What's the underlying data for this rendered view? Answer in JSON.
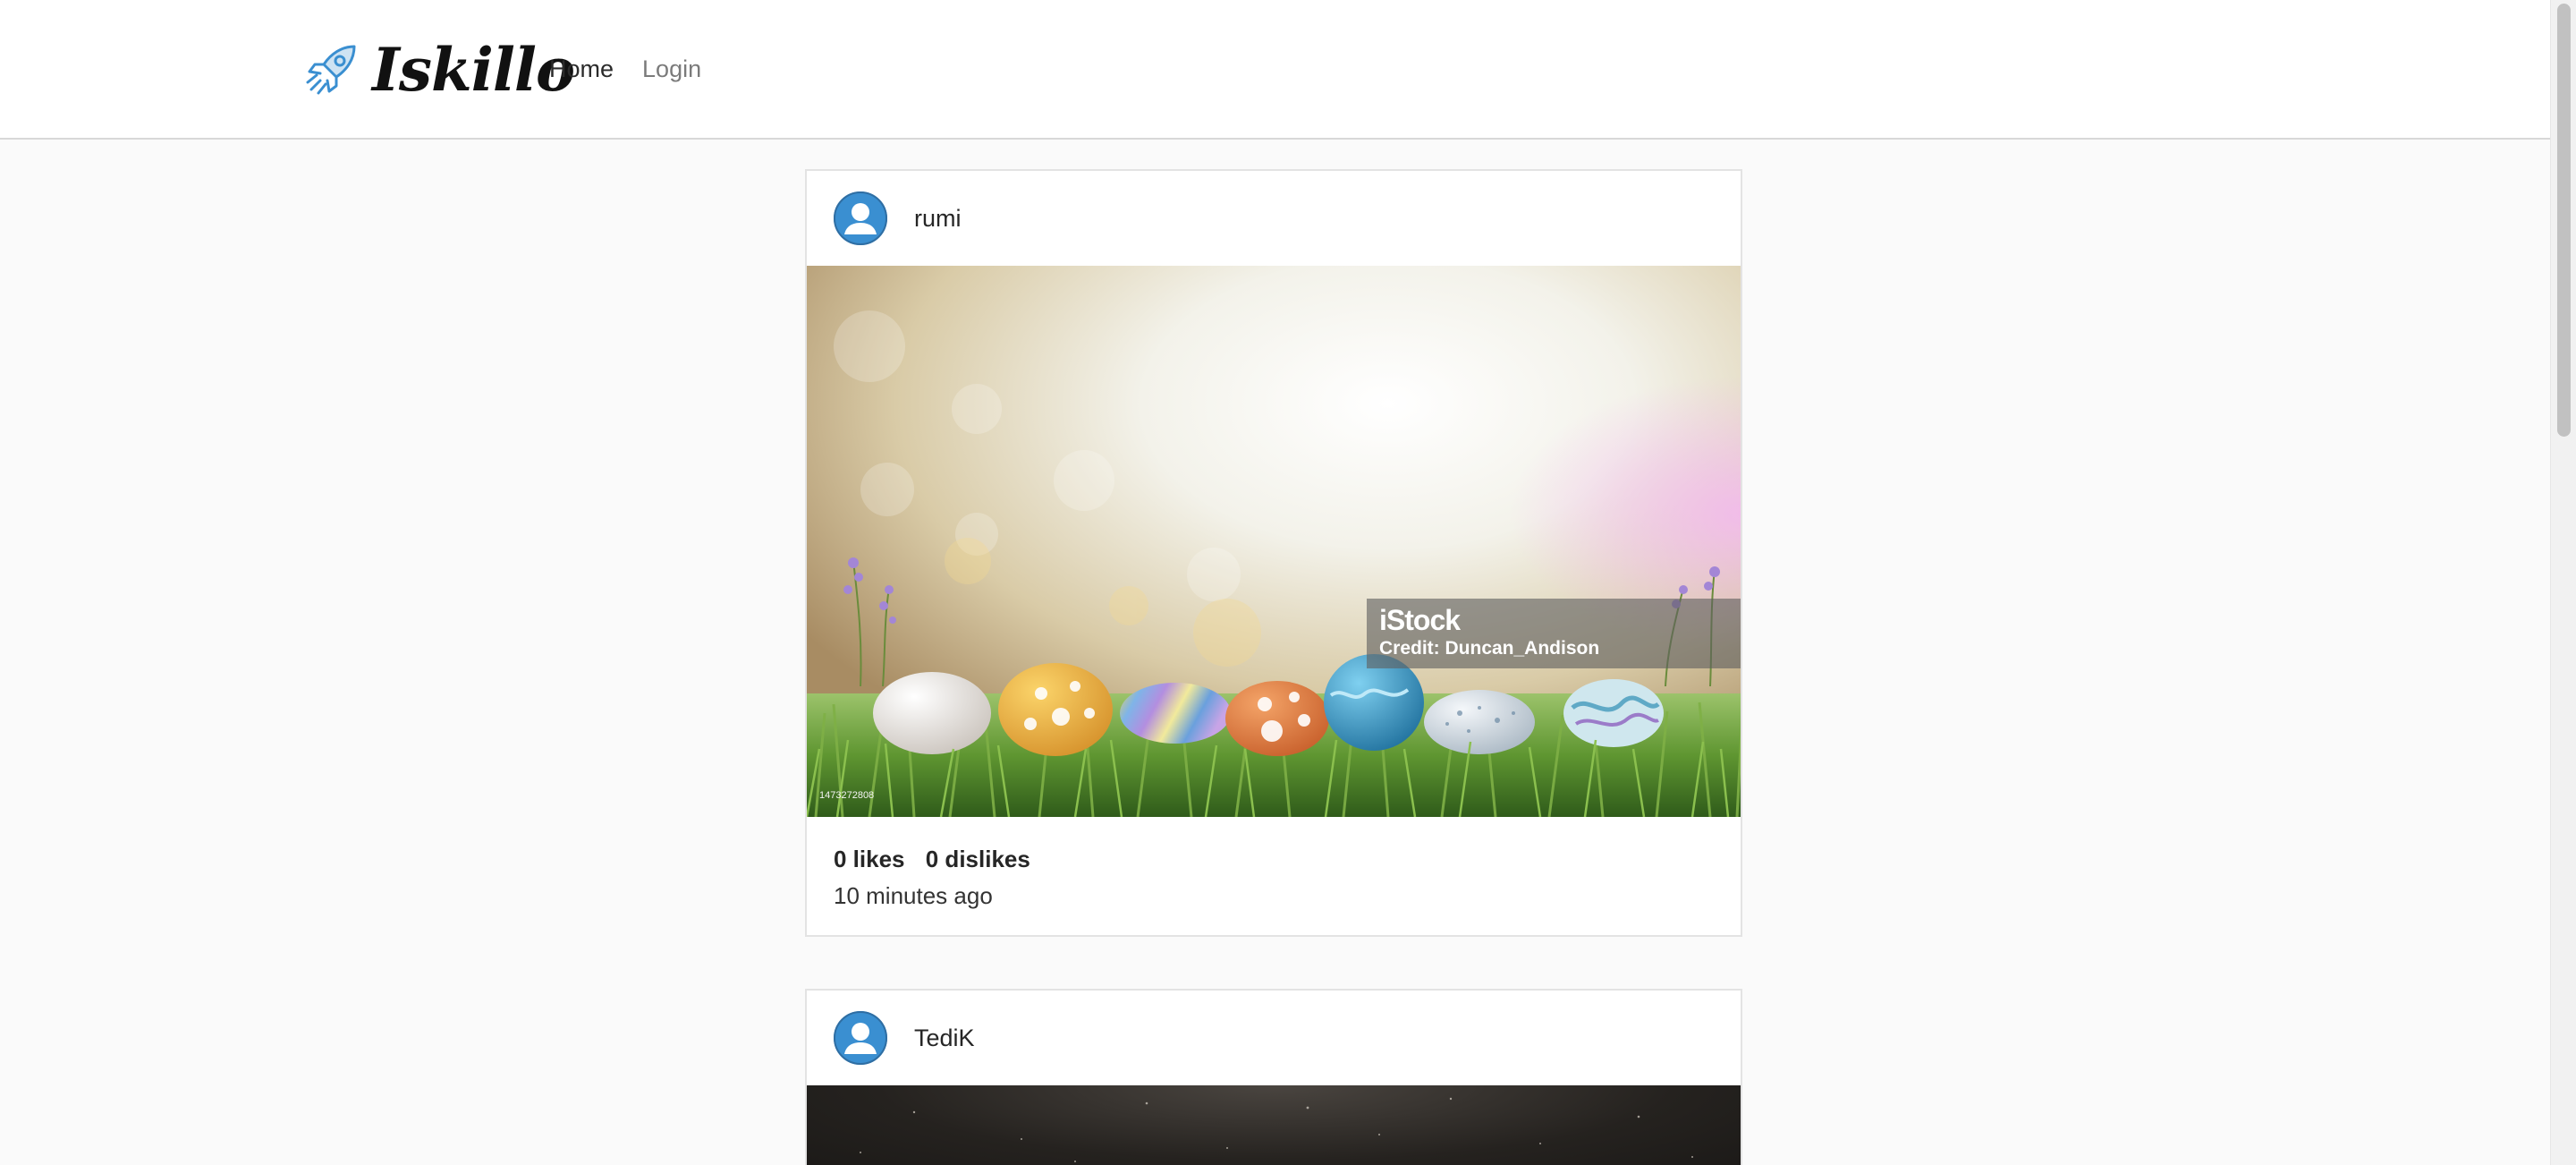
{
  "header": {
    "brand": "Iskillo",
    "nav": [
      {
        "label": "Home",
        "active": true
      },
      {
        "label": "Login",
        "active": false
      }
    ]
  },
  "posts": [
    {
      "username": "rumi",
      "image": {
        "watermark_logo": "iStock",
        "credit": "Credit: Duncan_Andison",
        "image_id": "1473272808"
      },
      "likes": "0 likes",
      "dislikes": "0 dislikes",
      "time": "10 minutes ago"
    },
    {
      "username": "TediK"
    }
  ],
  "colors": {
    "accent": "#3a8fd1",
    "page_bg": "#fafafa",
    "card_border": "#e3e3e3"
  },
  "icons": {
    "brand": "rocket-icon",
    "avatar": "user-avatar-icon"
  }
}
